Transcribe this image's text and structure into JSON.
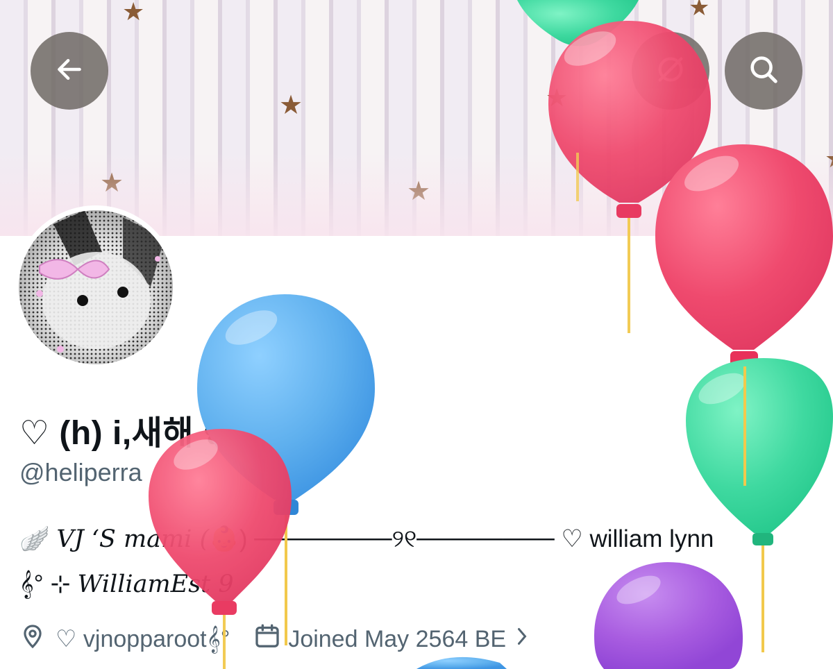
{
  "header": {
    "back_icon": "arrow-left-icon",
    "grok_icon": "grok-icon",
    "search_icon": "search-icon"
  },
  "profile": {
    "display_name": "♡ (h) i,새해 ✿ ◞°",
    "handle": "@heliperra",
    "bio_line1_prefix": "🪽",
    "bio_line1_script": "VJ ‘S mami (",
    "bio_line1_emoji": "👶",
    "bio_line1_rest": ") ────────୨୧──────── ♡ william lynn",
    "bio_line2_symbol": "𝄞° ⊹",
    "bio_line2_script": "WilliamEst 9",
    "location": "♡ vjnopparoot𝄞°",
    "joined": "Joined May 2564 BE"
  },
  "colors": {
    "handle_gray": "#536471",
    "balloon_red": "#ef4a6e",
    "balloon_blue": "#5fb0ee",
    "balloon_green": "#3fd9a0",
    "balloon_purple": "#a85ce0"
  }
}
